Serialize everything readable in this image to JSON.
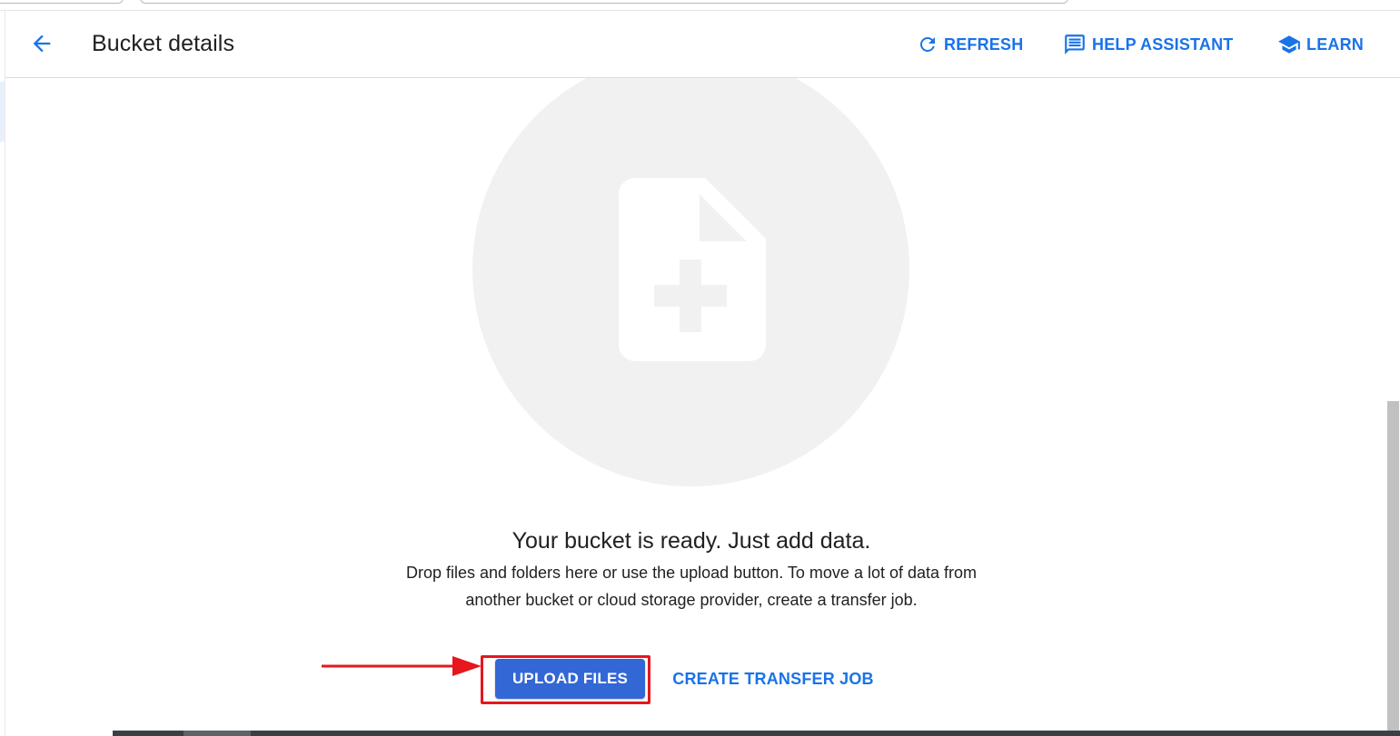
{
  "header": {
    "title": "Bucket details",
    "back_icon": "arrow-back-icon",
    "actions": [
      {
        "label": "REFRESH",
        "icon": "refresh-icon"
      },
      {
        "label": "HELP ASSISTANT",
        "icon": "help-assistant-icon"
      },
      {
        "label": "LEARN",
        "icon": "school-icon"
      }
    ]
  },
  "empty_state": {
    "illustration_icon": "file-add-icon",
    "title": "Your bucket is ready. Just add data.",
    "description_line1": "Drop files and folders here or use the upload button. To move a lot of data from",
    "description_line2": "another bucket or cloud storage provider, create a transfer job.",
    "primary_button": "UPLOAD FILES",
    "secondary_button": "CREATE TRANSFER JOB"
  },
  "annotation": {
    "arrow_icon": "red-arrow-icon",
    "highlight_color": "#e6171d"
  },
  "colors": {
    "accent": "#1a73e8",
    "primary_button_bg": "#3367d6",
    "text": "#202124",
    "illustration_bg": "#f1f1f1",
    "illustration_fg": "#ffffff"
  }
}
